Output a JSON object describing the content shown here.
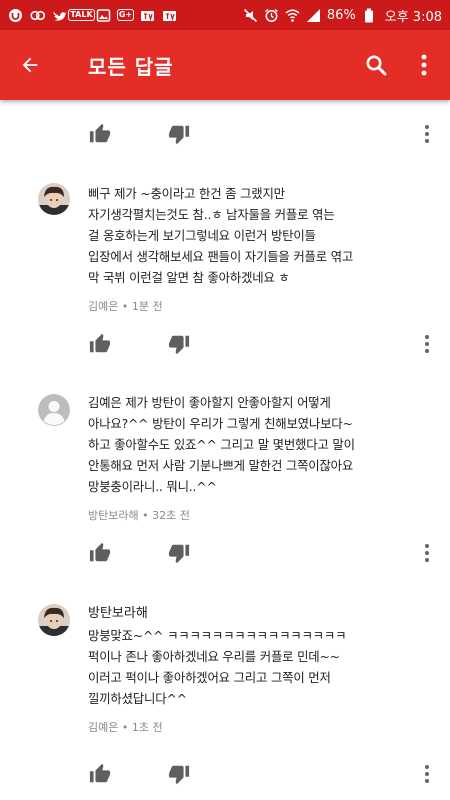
{
  "status_bar": {
    "battery": "86%",
    "time": "오후 3:08",
    "left_icons": [
      "notification-icon",
      "ocb-icon",
      "twitter-icon",
      "talk-icon",
      "gallery-icon",
      "gplus-icon",
      "tv-icon",
      "tv-icon"
    ],
    "right_icons": [
      "mute-icon",
      "alarm-icon",
      "wifi-icon",
      "signal-icon",
      "battery-icon"
    ]
  },
  "app_bar": {
    "title": "모든 답글",
    "color": "#e52d27",
    "status_color": "#cc1a1a",
    "icons": [
      "back-arrow-icon",
      "search-icon",
      "more-vert-icon"
    ]
  },
  "comments": [
    {
      "author": "",
      "text": "삐구 제가 ~충이라고 한건 좀 그랬지만\n자기생각펼치는것도 참..ㅎ 남자둘을 커플로 엮는\n걸 옹호하는게 보기그렇네요 이런거 방탄이들\n입장에서 생각해보세요 팬들이 자기들을 커플로 엮고\n막 국뷔 이런걸 알면 참 좋아하겠네요 ㅎ",
      "meta": "김예은 • 1분 전",
      "avatar": "photo"
    },
    {
      "author": "",
      "text": "김예은 제가 방탄이 좋아할지 안좋아할지 어떻게\n아나요?^^ 방탄이 우리가 그렇게 친해보였나보다~\n하고 좋아할수도 있죠^^ 그리고 말 몇번했다고 말이\n안통해요 먼저 사람 기분나쁘게 말한건 그쪽이잖아요\n망붕충이라니.. 뭐니..^^",
      "meta": "방탄보라해 • 32초 전",
      "avatar": "default"
    },
    {
      "author": "방탄보라해",
      "text": "망붕맞죠~^^ ㅋㅋㅋㅋㅋㅋㅋㅋㅋㅋㅋㅋㅋㅋㅋㅋ\n퍽이나 존나 좋아하겠네요 우리를 커플로 민데~~\n이러고 퍽이나 좋아하겠어요 그리고 그쪽이 먼저\n낄끼하셨답니다^^",
      "meta": "김예은 • 1초 전",
      "avatar": "photo"
    }
  ]
}
